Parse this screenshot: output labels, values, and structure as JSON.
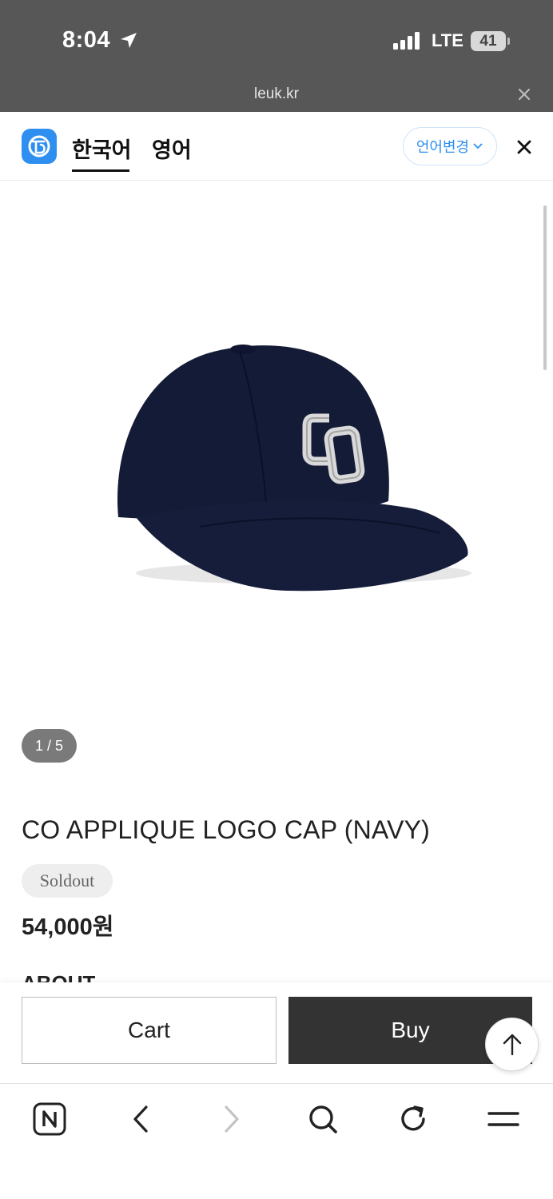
{
  "status_bar": {
    "time": "8:04",
    "network": "LTE",
    "battery": "41"
  },
  "url_bar": {
    "domain": "leuk.kr"
  },
  "translate_bar": {
    "tab_source": "한국어",
    "tab_target": "영어",
    "change_language_label": "언어변경"
  },
  "product": {
    "image_counter": "1 / 5",
    "title": "CO APPLIQUE LOGO CAP (NAVY)",
    "status_badge": "Soldout",
    "price": "54,000원",
    "section_heading": "ABOUT"
  },
  "purchase_bar": {
    "cart_label": "Cart",
    "buy_label": "Buy"
  },
  "colors": {
    "accent": "#2f8ff0",
    "buy_button": "#333333",
    "cap_navy": "#141b36"
  },
  "icons": {
    "location": "location-arrow-icon",
    "signal": "cellular-signal-icon",
    "translator": "papago-logo-icon",
    "scroll_top": "arrow-up-icon",
    "browser_home": "naver-n-icon"
  }
}
